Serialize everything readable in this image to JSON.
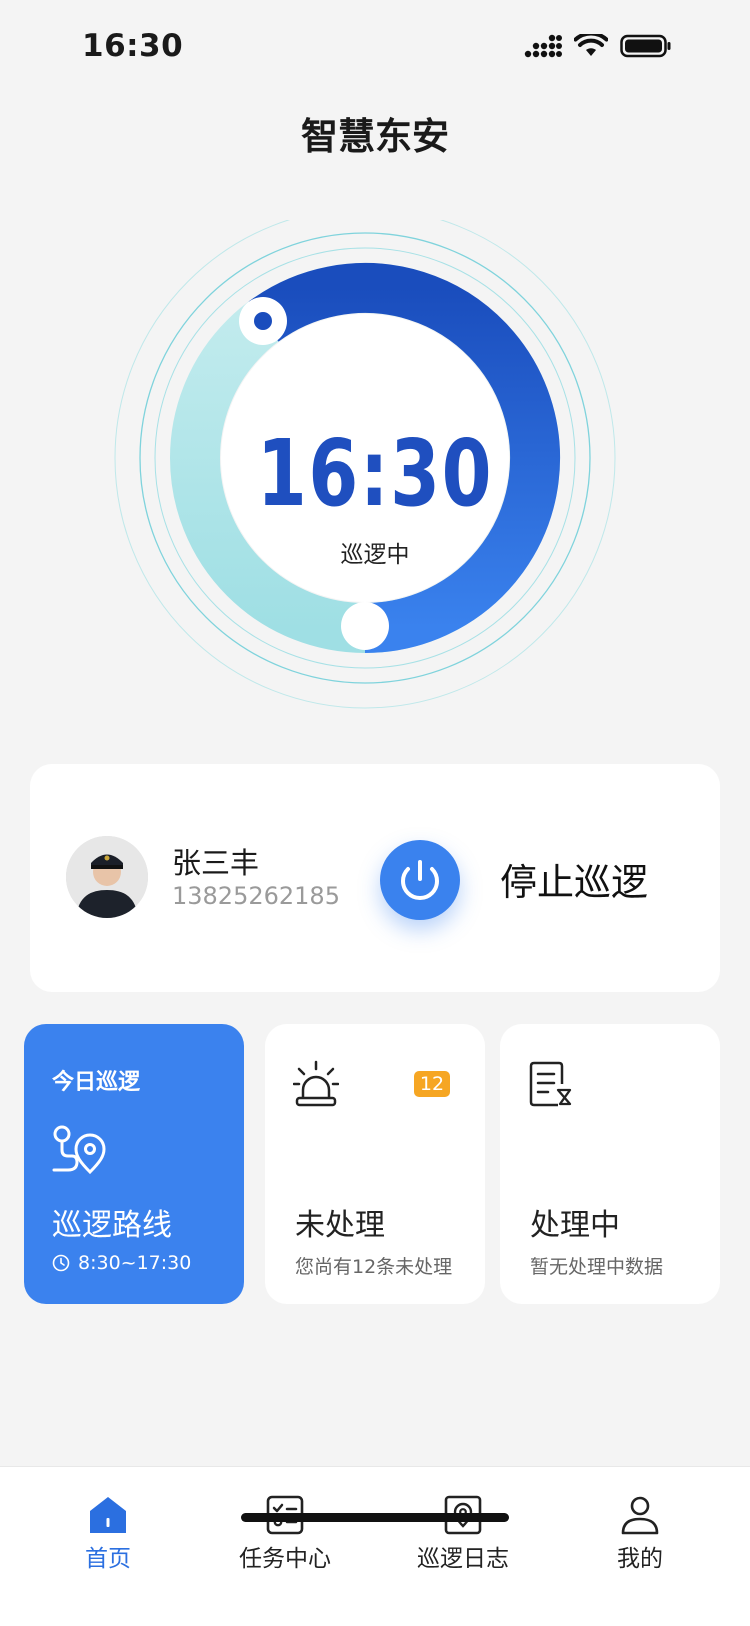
{
  "status_bar": {
    "time": "16:30"
  },
  "header": {
    "title": "智慧东安"
  },
  "dial": {
    "time": "16:30",
    "status": "巡逻中",
    "progress_fraction": 0.67
  },
  "profile": {
    "name": "张三丰",
    "phone": "13825262185",
    "stop_label": "停止巡逻"
  },
  "tiles": {
    "patrol": {
      "small_title": "今日巡逻",
      "title": "巡逻路线",
      "time_range": "8:30~17:30"
    },
    "unhandled": {
      "title": "未处理",
      "badge": "12",
      "desc": "您尚有12条未处理"
    },
    "processing": {
      "title": "处理中",
      "desc": "暂无处理中数据"
    }
  },
  "tabs": [
    {
      "label": "首页",
      "icon": "home-icon",
      "active": true
    },
    {
      "label": "任务中心",
      "icon": "task-list-icon",
      "active": false
    },
    {
      "label": "巡逻日志",
      "icon": "location-log-icon",
      "active": false
    },
    {
      "label": "我的",
      "icon": "user-icon",
      "active": false
    }
  ],
  "colors": {
    "primary": "#3b82ee",
    "dial_dark": "#1a4dbd",
    "dial_teal": "#9fdfe4",
    "badge": "#f6a623",
    "background": "#f4f4f4"
  }
}
